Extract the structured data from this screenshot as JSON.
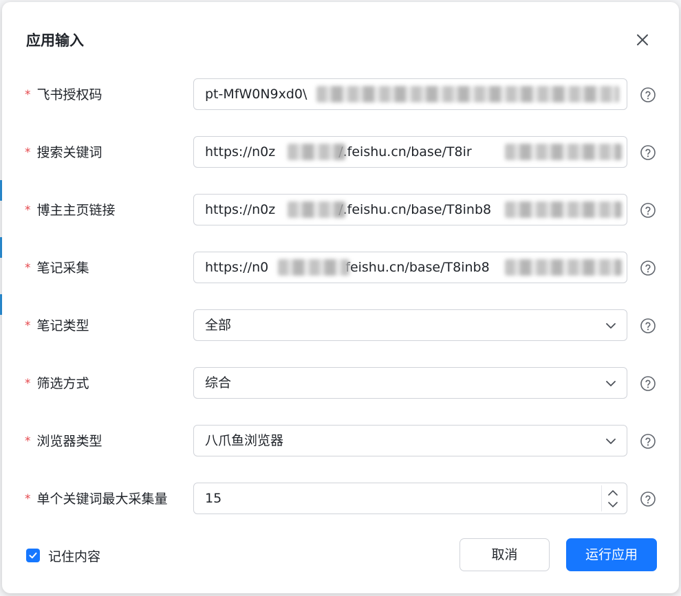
{
  "dialog": {
    "title": "应用输入",
    "close_icon": "close-icon"
  },
  "fields": [
    {
      "label": "飞书授权码",
      "required": true,
      "type": "text",
      "value": "pt-MfW0N9xd0\\"
    },
    {
      "label": "搜索关键词",
      "required": true,
      "type": "text",
      "value": "https://n0z",
      "value_tail": "/.feishu.cn/base/T8ir"
    },
    {
      "label": "博主主页链接",
      "required": true,
      "type": "text",
      "value": "https://n0z",
      "value_tail": "/.feishu.cn/base/T8inb8"
    },
    {
      "label": "笔记采集",
      "required": true,
      "type": "text",
      "value": "https://n0",
      "value_tail": "feishu.cn/base/T8inb8"
    },
    {
      "label": "笔记类型",
      "required": true,
      "type": "select",
      "value": "全部"
    },
    {
      "label": "筛选方式",
      "required": true,
      "type": "select",
      "value": "综合"
    },
    {
      "label": "浏览器类型",
      "required": true,
      "type": "select",
      "value": "八爪鱼浏览器"
    },
    {
      "label": "单个关键词最大采集量",
      "required": true,
      "type": "number",
      "value": "15"
    }
  ],
  "required_mark": "*",
  "footer": {
    "remember_label": "记住内容",
    "remember_checked": true,
    "cancel_label": "取消",
    "run_label": "运行应用"
  },
  "colors": {
    "primary": "#1677ff",
    "required": "#e5484d",
    "border": "#d0d3d9",
    "text": "#1f2329"
  }
}
